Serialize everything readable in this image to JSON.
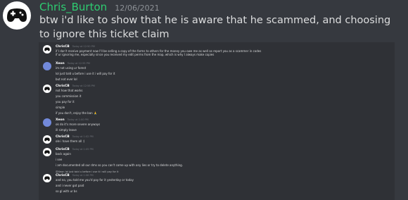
{
  "message": {
    "username": "Chris_Burton",
    "timestamp": "12/06/2021",
    "text": "btw i'd like to show that he is aware that he scammed, and choosing to ignore this ticket claim"
  },
  "embedded_chat": {
    "messages": [
      {
        "author": "ChrisCB",
        "time": "Today at 12:50 PM",
        "avatar": "gamepad-icon",
        "lines": [
          "if I don't receive payment now I'll be selling a copy of the farms to others for the money you owe me as well as report you as a scammer in codes",
          "if ur ignoring me, especially since you received my edit perms from the map, which is why I always make copies"
        ]
      },
      {
        "author": "Xeon",
        "time": "Today at 12:55 PM",
        "avatar": "purple-avatar",
        "lines": [
          "im not using ur forest",
          "lol just told u before i use it i will pay for it",
          "but not ever lol"
        ]
      },
      {
        "author": "ChrisCB",
        "time": "Today at 12:58 PM",
        "avatar": "gamepad-icon",
        "lines": [
          "not how that works",
          "you commission it",
          "you pay for it",
          "simple",
          "if you don't, enjoy the ban 🙏"
        ]
      },
      {
        "author": "Xeon",
        "time": "Today at 1:00 PM",
        "avatar": "purple-avatar",
        "lines": [
          "ok do it's more severe anyways",
          "ill simply leave"
        ]
      },
      {
        "author": "ChrisCB",
        "time": "Today at 1:02 PM",
        "avatar": "gamepad-icon",
        "lines": [
          "ole i have them all :)"
        ]
      },
      {
        "author": "ChrisCB",
        "time": "Today at 1:05 PM",
        "avatar": "gamepad-icon",
        "lines": [
          "back again",
          "i see",
          "i am documented all our dms so you can't come up with any lies or try to delete anything."
        ]
      },
      {
        "author": "ChrisCB",
        "time": "Today at 1:08 PM",
        "avatar": "gamepad-icon",
        "reply": "@Xeon lol just told u before i use it i will pay for it",
        "lines": [
          "and no, you told me you'd pay for it yesterday or today",
          "and i never got paid",
          "so gl with ur bs"
        ]
      }
    ]
  }
}
